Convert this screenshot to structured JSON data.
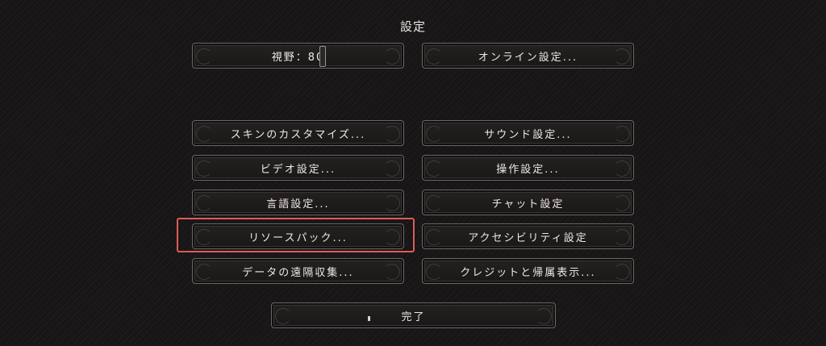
{
  "screen": {
    "title": "設定"
  },
  "controls": {
    "fov_label": "視野：80",
    "fov_value": 80,
    "online": "オンライン設定..."
  },
  "left_column": [
    "スキンのカスタマイズ...",
    "ビデオ設定...",
    "言語設定...",
    "リソースパック...",
    "データの遠隔収集..."
  ],
  "right_column": [
    "サウンド設定...",
    "操作設定...",
    "チャット設定",
    "アクセシビリティ設定",
    "クレジットと帰属表示..."
  ],
  "footer": {
    "done": "完了"
  },
  "colors": {
    "background": "#161414",
    "button_border": "#6d6763",
    "selection_highlight": "#e05a5a",
    "text": "#ece8e4"
  }
}
